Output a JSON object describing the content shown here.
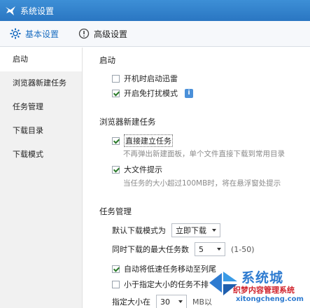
{
  "window": {
    "title": "系统设置"
  },
  "tabs": [
    {
      "label": "基本设置"
    },
    {
      "label": "高级设置"
    }
  ],
  "sidebar": {
    "items": [
      {
        "label": "启动"
      },
      {
        "label": "浏览器新建任务"
      },
      {
        "label": "任务管理"
      },
      {
        "label": "下载目录"
      },
      {
        "label": "下载模式"
      }
    ]
  },
  "startup": {
    "title": "启动",
    "autostart_label": "开机时启动迅雷",
    "autostart_checked": false,
    "nodisturb_label": "开启免打扰模式",
    "nodisturb_checked": true
  },
  "browser": {
    "title": "浏览器新建任务",
    "direct_label": "直接建立任务",
    "direct_checked": true,
    "direct_desc": "不再弹出新建面板，单个文件直接下载到常用目录",
    "bigfile_label": "大文件提示",
    "bigfile_checked": true,
    "bigfile_desc": "当任务的大小超过100MB时，将在悬浮窗处提示"
  },
  "taskmgr": {
    "title": "任务管理",
    "default_mode_label": "默认下载模式为",
    "default_mode_value": "立即下载",
    "max_tasks_label": "同时下载的最大任务数",
    "max_tasks_value": "5",
    "max_tasks_hint": "(1-50)",
    "auto_move_label": "自动将低速任务移动至列尾",
    "auto_move_checked": true,
    "small_task_label": "小于指定大小的任务不排",
    "small_task_checked": false,
    "size_label": "指定大小在",
    "size_value": "30",
    "size_unit": "MB以"
  },
  "watermark": {
    "brand": "系统城",
    "sub": "织梦内容管理系统",
    "url": "xitongcheng.com"
  },
  "colors": {
    "titlebar": "#2a76c2",
    "accent": "#1d6fc2",
    "sidebar_bg": "#f1f1f1"
  }
}
